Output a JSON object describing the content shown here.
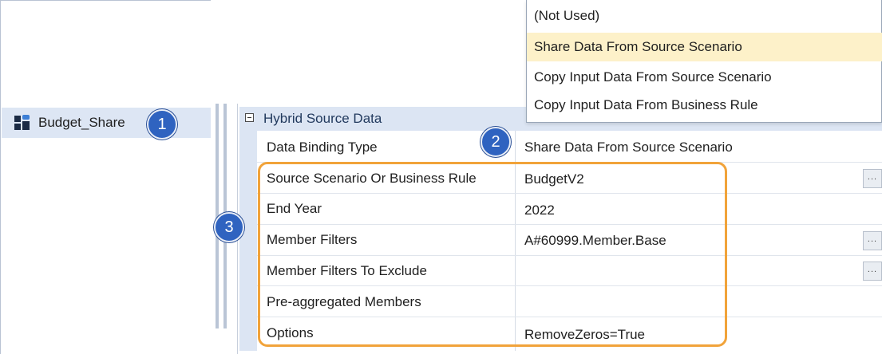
{
  "tree": {
    "item_label": "Budget_Share",
    "icon": "cube-icon"
  },
  "dropdown": {
    "options": [
      "(Not Used)",
      "Share Data From Source Scenario",
      "Copy Input Data From Source Scenario",
      "Copy Input Data From Business Rule"
    ],
    "selected_index": 1
  },
  "property_grid": {
    "category": "Hybrid Source Data",
    "rows": [
      {
        "label": "Data Binding Type",
        "value": "Share Data From Source Scenario",
        "has_button": false
      },
      {
        "label": "Source Scenario Or Business Rule",
        "value": "BudgetV2",
        "has_button": true
      },
      {
        "label": "End Year",
        "value": "2022",
        "has_button": false
      },
      {
        "label": "Member Filters",
        "value": "A#60999.Member.Base",
        "has_button": true
      },
      {
        "label": "Member Filters To Exclude",
        "value": "",
        "has_button": true
      },
      {
        "label": "Pre-aggregated Members",
        "value": "",
        "has_button": false
      },
      {
        "label": "Options",
        "value": "RemoveZeros=True",
        "has_button": false
      }
    ],
    "button_label": "..."
  },
  "callouts": [
    "1",
    "2",
    "3"
  ],
  "colors": {
    "callout": "#2f63c0",
    "highlight": "#f1a33a",
    "selected_option": "#fdf1c9",
    "tree_selection": "#dde6f4"
  }
}
